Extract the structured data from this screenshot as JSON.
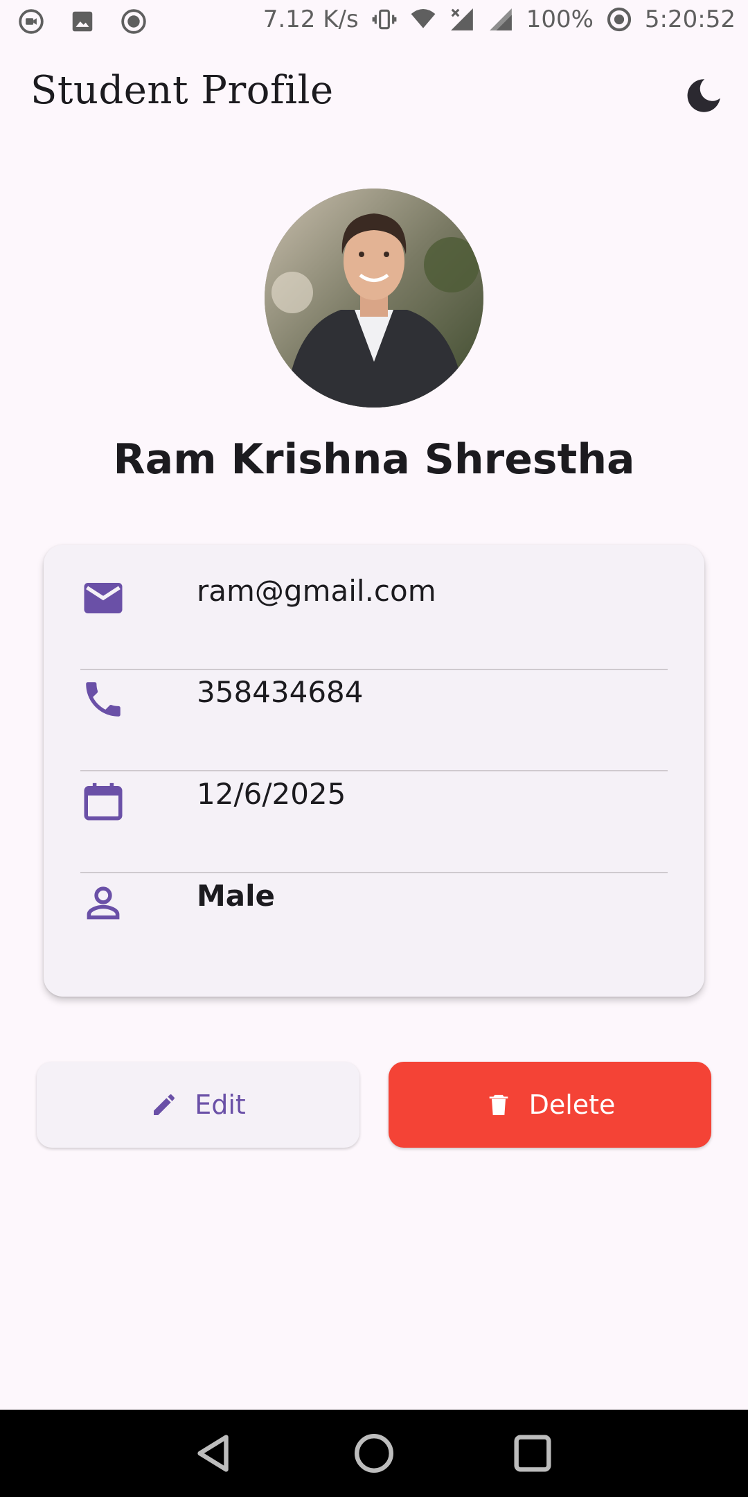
{
  "status_bar": {
    "net_speed": "7.12 K/s",
    "battery": "100%",
    "time": "5:20:52"
  },
  "app_bar": {
    "title": "Student Profile",
    "theme_toggle_icon": "moon-icon"
  },
  "profile": {
    "name": "Ram Krishna Shrestha",
    "avatar_icon": "profile-photo"
  },
  "details": {
    "email": {
      "icon": "email-icon",
      "value": "ram@gmail.com"
    },
    "phone": {
      "icon": "phone-icon",
      "value": "358434684"
    },
    "dob": {
      "icon": "calendar-icon",
      "value": "12/6/2025"
    },
    "gender": {
      "icon": "person-icon",
      "value": "Male"
    }
  },
  "actions": {
    "edit_label": "Edit",
    "delete_label": "Delete"
  },
  "colors": {
    "accent": "#6a50a7",
    "danger": "#f44336",
    "background": "#fdf7fc",
    "card": "#f5f1f7"
  }
}
